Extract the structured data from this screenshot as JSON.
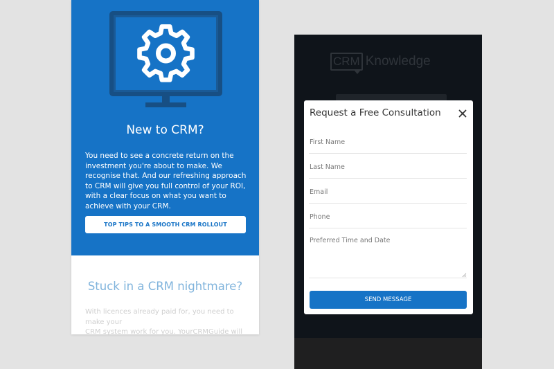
{
  "left_screen": {
    "hero": {
      "icon": "gear-monitor-icon",
      "title": "New to CRM?",
      "text": "You need to see a concrete return on the investment you're about to make. We recognise that. And our refreshing approach to CRM will give you full control of your ROI, with a clear focus on what you want to achieve with your CRM.",
      "button_label": "TOP TIPS TO A SMOOTH CRM ROLLOUT"
    },
    "section2": {
      "title": "Stuck in a CRM nightmare?",
      "text": "With licences already paid for, you need to make your\nCRM system work for you. YourCRMGuide will get"
    }
  },
  "right_screen": {
    "logo": {
      "box_text": "CRM",
      "word": "Knowledge"
    },
    "modal": {
      "title": "Request a Free Consultation",
      "close_icon": "close-icon",
      "fields": {
        "first_name": "First Name",
        "last_name": "Last Name",
        "email": "Email",
        "phone": "Phone",
        "preferred_time": "Preferred Time and Date"
      },
      "send_label": "SEND MESSAGE"
    }
  },
  "colors": {
    "brand_blue": "#1673c6",
    "background": "#e3e3e3",
    "dark_overlay": "#0f141a",
    "light_blue_heading": "#7fb3dc"
  }
}
